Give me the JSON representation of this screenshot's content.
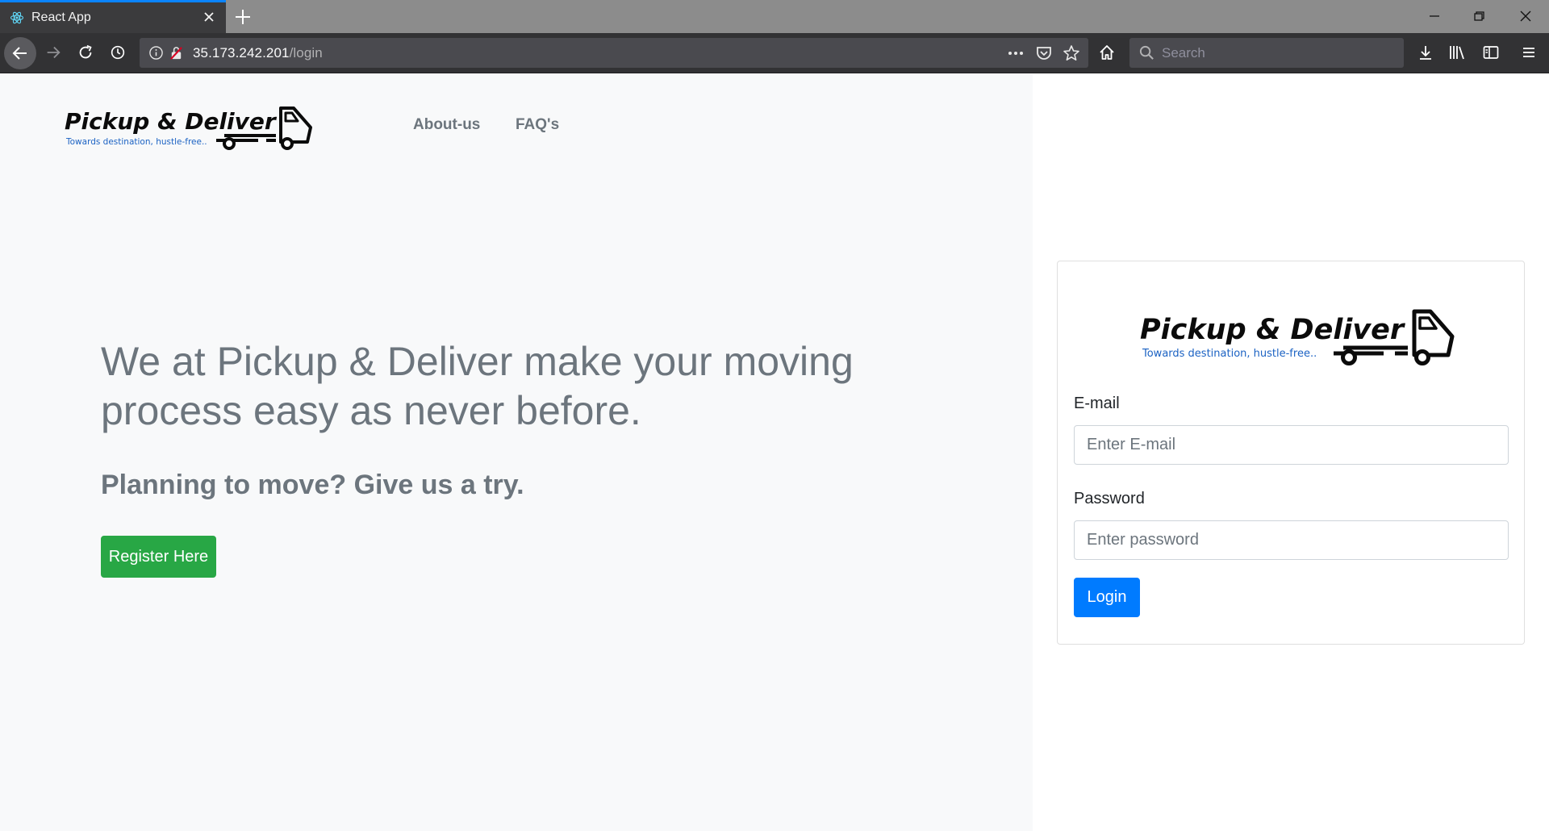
{
  "browser": {
    "tab_title": "React App",
    "url_host": "35.173.242.201",
    "url_path": "/login",
    "search_placeholder": "Search"
  },
  "brand": {
    "name": "Pickup & Deliver",
    "tagline": "Towards destination, hustle-free.."
  },
  "nav": {
    "links": [
      "About-us",
      "FAQ's"
    ]
  },
  "hero": {
    "title": "We at Pickup & Deliver make your moving process easy as never before.",
    "subtitle": "Planning to move? Give us a try.",
    "register_label": "Register Here"
  },
  "login": {
    "email_label": "E-mail",
    "email_placeholder": "Enter E-mail",
    "password_label": "Password",
    "password_placeholder": "Enter password",
    "login_label": "Login"
  },
  "colors": {
    "primary": "#007bff",
    "success": "#28a745",
    "muted": "#6c757d",
    "tab_accent": "#0a84ff"
  }
}
